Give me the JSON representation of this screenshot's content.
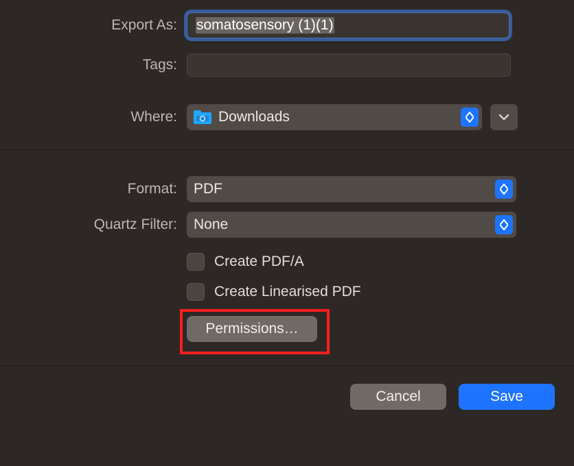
{
  "export": {
    "label": "Export As:",
    "value": "somatosensory (1)(1)"
  },
  "tags": {
    "label": "Tags:"
  },
  "where": {
    "label": "Where:",
    "value": "Downloads"
  },
  "format": {
    "label": "Format:",
    "value": "PDF"
  },
  "quartz": {
    "label": "Quartz Filter:",
    "value": "None"
  },
  "options": {
    "create_pdfa": "Create PDF/A",
    "create_linearised": "Create Linearised PDF"
  },
  "permissions_label": "Permissions…",
  "buttons": {
    "cancel": "Cancel",
    "save": "Save"
  }
}
